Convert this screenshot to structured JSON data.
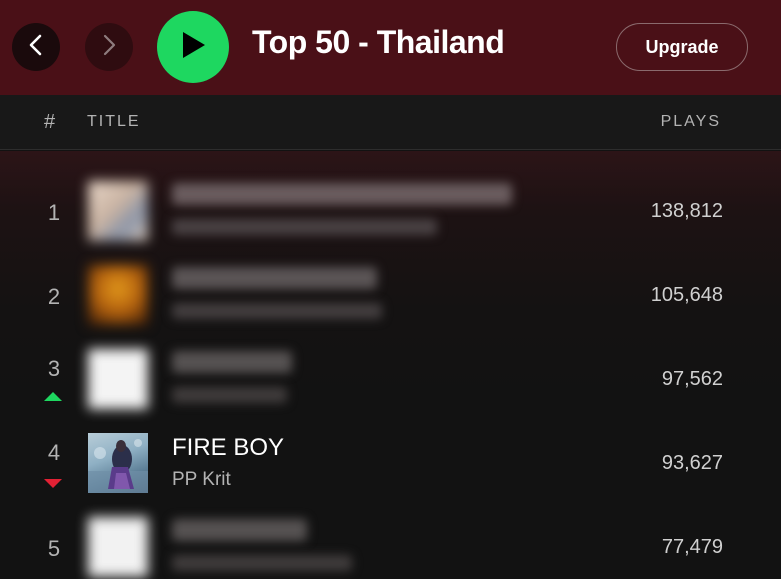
{
  "header": {
    "back_icon": "chevron-left-icon",
    "forward_icon": "chevron-right-icon",
    "play_icon": "play-icon",
    "title": "Top 50 - Thailand",
    "upgrade_label": "Upgrade",
    "accent": "#1ed760",
    "background": "#4a1017"
  },
  "table": {
    "col_hash": "#",
    "col_title": "TITLE",
    "col_plays": "PLAYS"
  },
  "tracks": [
    {
      "rank": "1",
      "title": "",
      "artist": "",
      "plays": "138,812",
      "trend": "none",
      "blurred": true
    },
    {
      "rank": "2",
      "title": "",
      "artist": "",
      "plays": "105,648",
      "trend": "none",
      "blurred": true
    },
    {
      "rank": "3",
      "title": "",
      "artist": "",
      "plays": "97,562",
      "trend": "up",
      "blurred": true
    },
    {
      "rank": "4",
      "title": "FIRE BOY",
      "artist": "PP Krit",
      "plays": "93,627",
      "trend": "down",
      "blurred": false
    },
    {
      "rank": "5",
      "title": "",
      "artist": "",
      "plays": "77,479",
      "trend": "none",
      "blurred": true
    }
  ],
  "trend_colors": {
    "up": "#1ed760",
    "down": "#e22134"
  }
}
